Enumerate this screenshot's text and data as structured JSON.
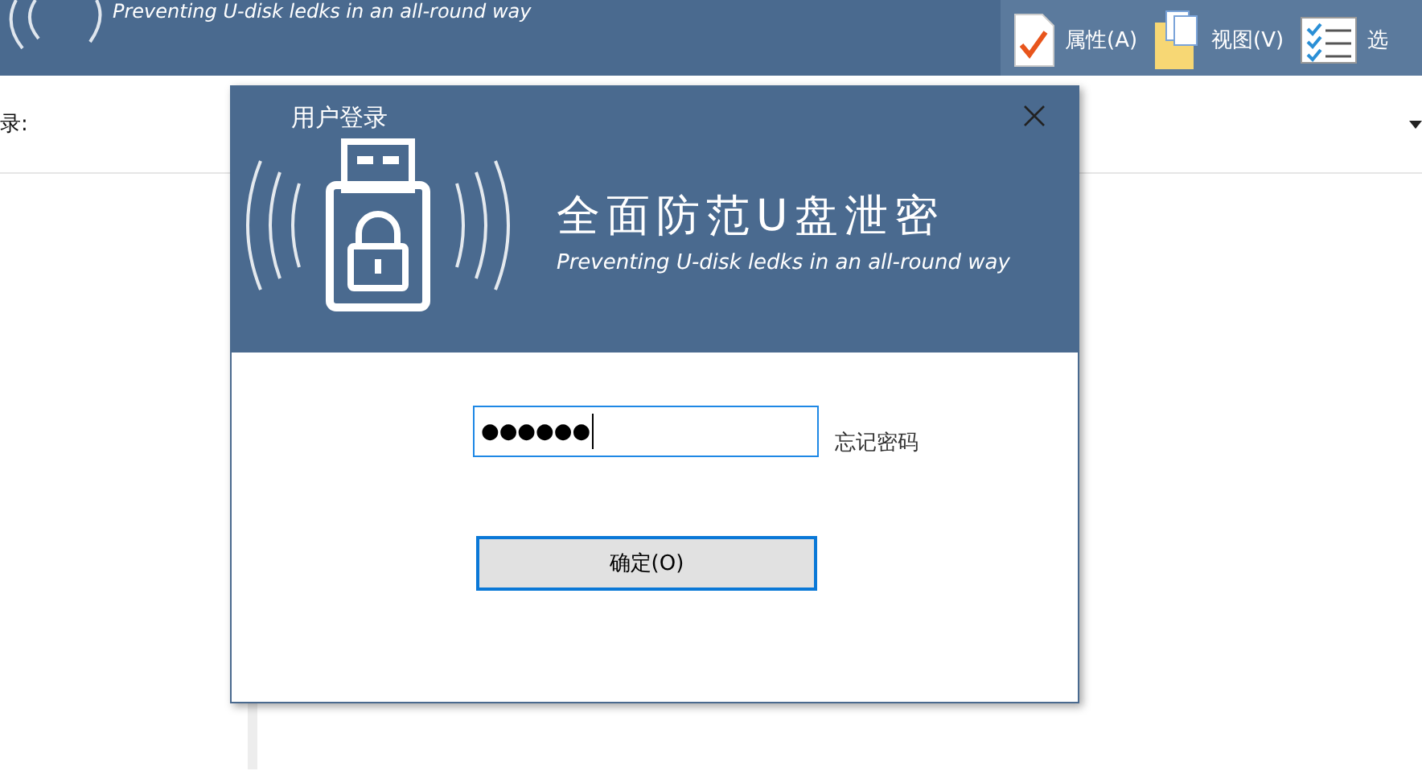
{
  "app": {
    "slogan": "Preventing U-disk ledks in an all-round way",
    "toolbar": [
      {
        "label": "属性(A)",
        "kind": "properties"
      },
      {
        "label": "视图(V)",
        "kind": "view"
      },
      {
        "label": "选",
        "kind": "options"
      }
    ],
    "directory_label": "录:"
  },
  "dialog": {
    "title": "用户登录",
    "heading": "全面防范U盘泄密",
    "slogan": "Preventing U-disk ledks in an all-round way",
    "password": {
      "value": "●●●●●●",
      "focused": true
    },
    "forgot_link": "忘记密码",
    "ok_button": "确定(O)"
  }
}
